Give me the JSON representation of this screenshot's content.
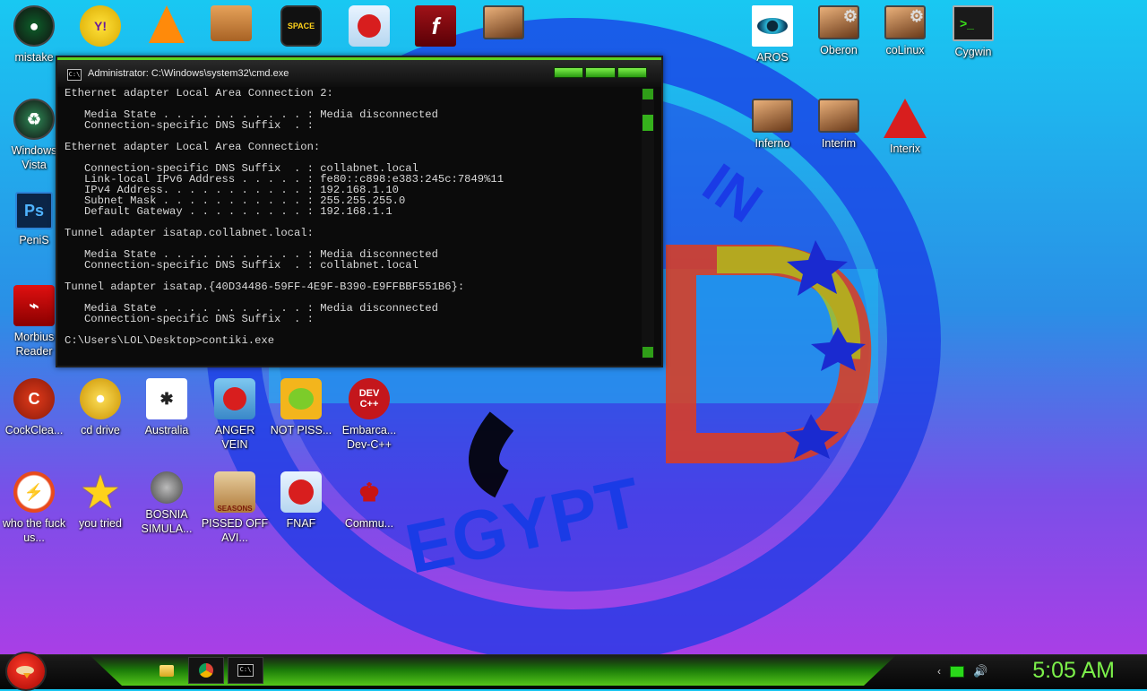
{
  "wallpaper": {
    "arc_text": "IN",
    "big_text": "CSD",
    "bottom_text": "EGYPT"
  },
  "desktop_icons": [
    {
      "label": "mistake",
      "icon": "mistake-icon"
    },
    {
      "label": "Windows Vista",
      "icon": "recycle-bin-icon"
    },
    {
      "label": "PeniS",
      "icon": "photoshop-icon"
    },
    {
      "label": "Morbius Reader",
      "icon": "pdf-reader-icon"
    },
    {
      "label": "CockClea...",
      "icon": "ccleaner-icon"
    },
    {
      "label": "cd drive",
      "icon": "cd-drive-icon"
    },
    {
      "label": "Australia",
      "icon": "spider-solitaire-icon"
    },
    {
      "label": "ANGER VEIN",
      "icon": "angry-birds-icon"
    },
    {
      "label": "NOT PISS...",
      "icon": "bad-piggies-icon"
    },
    {
      "label": "Embarca... Dev-C++",
      "icon": "devcpp-icon"
    },
    {
      "label": "who the fuck us...",
      "icon": "flash-app-icon"
    },
    {
      "label": "you tried",
      "icon": "star-icon"
    },
    {
      "label": "BOSNIA SIMULA...",
      "icon": "mine-icon"
    },
    {
      "label": "PISSED OFF AVI...",
      "icon": "angry-birds-seasons-icon"
    },
    {
      "label": "FNAF",
      "icon": "angry-birds-icon"
    },
    {
      "label": "Commu...",
      "icon": "communist-icon"
    },
    {
      "label": "AROS",
      "icon": "aros-eye-icon"
    },
    {
      "label": "Oberon",
      "icon": "settings-window-icon"
    },
    {
      "label": "coLinux",
      "icon": "settings-window-icon"
    },
    {
      "label": "Cygwin",
      "icon": "terminal-icon"
    },
    {
      "label": "Inferno",
      "icon": "app-window-icon"
    },
    {
      "label": "Interim",
      "icon": "app-window-icon"
    },
    {
      "label": "Interix",
      "icon": "interix-icon"
    }
  ],
  "top_icons_unlabeled": [
    "yahoo-messenger-icon",
    "vlc-icon",
    "briefcase-icon",
    "angry-birds-space-icon",
    "angry-birds-icon",
    "flash-player-icon",
    "app-window-icon"
  ],
  "cmd_window": {
    "title": "Administrator: C:\\Windows\\system32\\cmd.exe",
    "lines": [
      "Ethernet adapter Local Area Connection 2:",
      "",
      "   Media State . . . . . . . . . . . : Media disconnected",
      "   Connection-specific DNS Suffix  . :",
      "",
      "Ethernet adapter Local Area Connection:",
      "",
      "   Connection-specific DNS Suffix  . : collabnet.local",
      "   Link-local IPv6 Address . . . . . : fe80::c898:e383:245c:7849%11",
      "   IPv4 Address. . . . . . . . . . . : 192.168.1.10",
      "   Subnet Mask . . . . . . . . . . . : 255.255.255.0",
      "   Default Gateway . . . . . . . . . : 192.168.1.1",
      "",
      "Tunnel adapter isatap.collabnet.local:",
      "",
      "   Media State . . . . . . . . . . . : Media disconnected",
      "   Connection-specific DNS Suffix  . : collabnet.local",
      "",
      "Tunnel adapter isatap.{40D34486-59FF-4E9F-B390-E9FFBBF551B6}:",
      "",
      "   Media State . . . . . . . . . . . : Media disconnected",
      "   Connection-specific DNS Suffix  . :",
      "",
      "C:\\Users\\LOL\\Desktop>contiki.exe"
    ]
  },
  "taskbar": {
    "clock": "5:05 AM",
    "pinned": [
      "file-explorer-icon",
      "chrome-icon",
      "cmd-icon"
    ],
    "tray": [
      "chevron-left-icon",
      "network-icon",
      "volume-icon"
    ]
  },
  "colors": {
    "accent_green": "#5cd11e",
    "clock_green": "#7cf04a"
  }
}
